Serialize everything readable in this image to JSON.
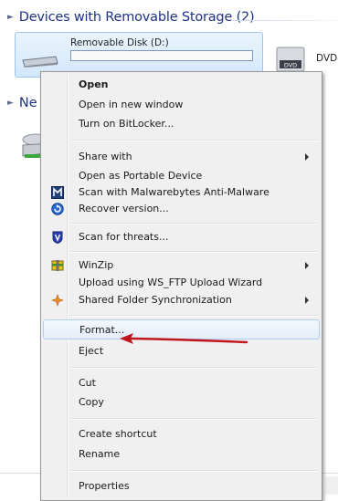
{
  "explorer": {
    "group_removable": "Devices with Removable Storage (2)",
    "group_network_partial": "Ne",
    "removable_disk_label": "Removable Disk (D:)",
    "dvd_label_partial": "DVD",
    "dvd_badge": "DVD"
  },
  "context_menu": {
    "items": [
      {
        "label": "Open",
        "bold": true
      },
      {
        "label": "Open in new window"
      },
      {
        "label": "Turn on BitLocker..."
      },
      {
        "label": "Share with",
        "submenu": true
      },
      {
        "label": "Open as Portable Device"
      },
      {
        "label": "Scan with Malwarebytes Anti-Malware",
        "icon": "malwarebytes-icon"
      },
      {
        "label": "Recover version...",
        "icon": "recover-icon"
      },
      {
        "label": "Scan for threats...",
        "icon": "shield-scan-icon"
      },
      {
        "label": "WinZip",
        "icon": "winzip-icon",
        "submenu": true
      },
      {
        "label": "Upload using WS_FTP Upload Wizard"
      },
      {
        "label": "Shared Folder Synchronization",
        "icon": "sync-icon",
        "submenu": true
      },
      {
        "label": "Format...",
        "highlighted": true
      },
      {
        "label": "Eject"
      },
      {
        "label": "Cut"
      },
      {
        "label": "Copy"
      },
      {
        "label": "Create shortcut"
      },
      {
        "label": "Rename"
      },
      {
        "label": "Properties"
      }
    ]
  },
  "colors": {
    "header_blue": "#1e3287",
    "highlight_border": "#aecff7",
    "annotation_arrow": "#c0161b"
  }
}
